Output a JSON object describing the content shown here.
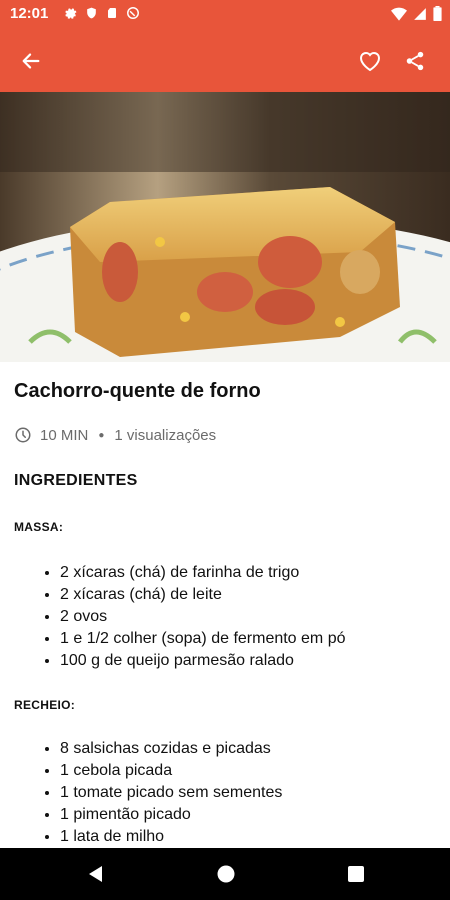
{
  "status_bar": {
    "time": "12:01",
    "left_icons": [
      "gear-icon",
      "shield-icon",
      "sim-card-icon",
      "no-disturb-icon"
    ],
    "right_icons": [
      "wifi-icon",
      "signal-icon",
      "battery-icon"
    ]
  },
  "app_bar": {
    "back_icon": "arrow-left-icon",
    "favorite_icon": "heart-outline-icon",
    "share_icon": "share-icon",
    "color": "#e8553a"
  },
  "recipe": {
    "title": "Cachorro-quente de forno",
    "time": "10 MIN",
    "views": "1 visualizações",
    "ingredients_heading": "INGREDIENTES",
    "sections": [
      {
        "name": "MASSA:",
        "items": [
          "2 xícaras (chá) de farinha de trigo",
          "2 xícaras (chá) de leite",
          "2 ovos",
          "1 e 1/2 colher (sopa) de fermento em pó",
          "100 g de queijo parmesão ralado"
        ]
      },
      {
        "name": "RECHEIO:",
        "items": [
          "8 salsichas cozidas e picadas",
          "1 cebola picada",
          "1 tomate picado sem sementes",
          "1 pimentão picado",
          "1 lata de milho"
        ]
      }
    ]
  },
  "nav_bar": {
    "back_icon": "triangle-back-icon",
    "home_icon": "circle-home-icon",
    "recents_icon": "square-recents-icon"
  }
}
